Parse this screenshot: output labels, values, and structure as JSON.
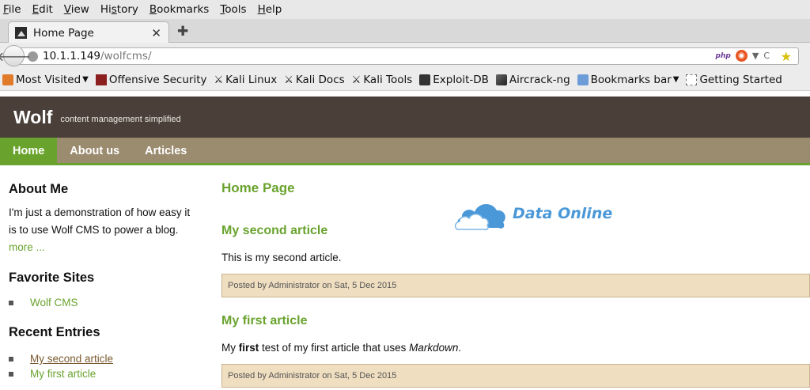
{
  "browser": {
    "menu": [
      {
        "label": "File",
        "mnemonic": "F",
        "rest": "ile"
      },
      {
        "label": "Edit",
        "mnemonic": "E",
        "rest": "dit"
      },
      {
        "label": "View",
        "mnemonic": "V",
        "rest": "iew"
      },
      {
        "label": "History",
        "mnemonic": "H",
        "pre": "Hi",
        "u": "s",
        "post": "tory"
      },
      {
        "label": "Bookmarks",
        "mnemonic": "B",
        "rest": "ookmarks"
      },
      {
        "label": "Tools",
        "mnemonic": "T",
        "rest": "ools"
      },
      {
        "label": "Help",
        "mnemonic": "H",
        "rest": "elp"
      }
    ],
    "tab": {
      "title": "Home Page",
      "close_glyph": "✕"
    },
    "new_tab_glyph": "✚",
    "url": {
      "host": "10.1.1.149",
      "path": "/wolfcms/"
    },
    "url_icons": {
      "php": "php",
      "dropdown": "▼",
      "reload": "C"
    },
    "bookmarks": [
      {
        "label": "Most Visited",
        "icon": "folder-icon",
        "dropdown": "▼"
      },
      {
        "label": "Offensive Security",
        "icon": "offsec-icon"
      },
      {
        "label": "Kali Linux",
        "icon": "kali-dragon-icon"
      },
      {
        "label": "Kali Docs",
        "icon": "kali-dragon-icon"
      },
      {
        "label": "Kali Tools",
        "icon": "kali-dragon-icon"
      },
      {
        "label": "Exploit-DB",
        "icon": "exploitdb-icon"
      },
      {
        "label": "Aircrack-ng",
        "icon": "aircrack-icon"
      },
      {
        "label": "Bookmarks bar",
        "icon": "folder-icon",
        "dropdown": "▼"
      },
      {
        "label": "Getting Started",
        "icon": "page-icon"
      }
    ]
  },
  "site": {
    "name": "Wolf",
    "slogan": "content management simplified",
    "nav": [
      "Home",
      "About us",
      "Articles"
    ],
    "active_nav": "Home",
    "accent_color": "#69a32e",
    "sidebar": {
      "about_title": "About Me",
      "about_text": "I'm just a demonstration of how easy it is to use Wolf CMS to power a blog.",
      "more_link": "more ...",
      "favorites_title": "Favorite Sites",
      "favorites": [
        "Wolf CMS"
      ],
      "recent_title": "Recent Entries",
      "recent": [
        "My second article",
        "My first article"
      ]
    },
    "content": {
      "page_title": "Home Page",
      "articles": [
        {
          "title": "My second article",
          "body": "This is my second article.",
          "meta": "Posted by Administrator on Sat, 5 Dec 2015"
        },
        {
          "title": "My first article",
          "body_pre": "My ",
          "body_bold": "first",
          "body_mid": " test of my first article that uses ",
          "body_em": "Markdown",
          "body_post": ".",
          "meta": "Posted by Administrator on Sat, 5 Dec 2015"
        }
      ]
    },
    "watermark": "Data Online"
  }
}
